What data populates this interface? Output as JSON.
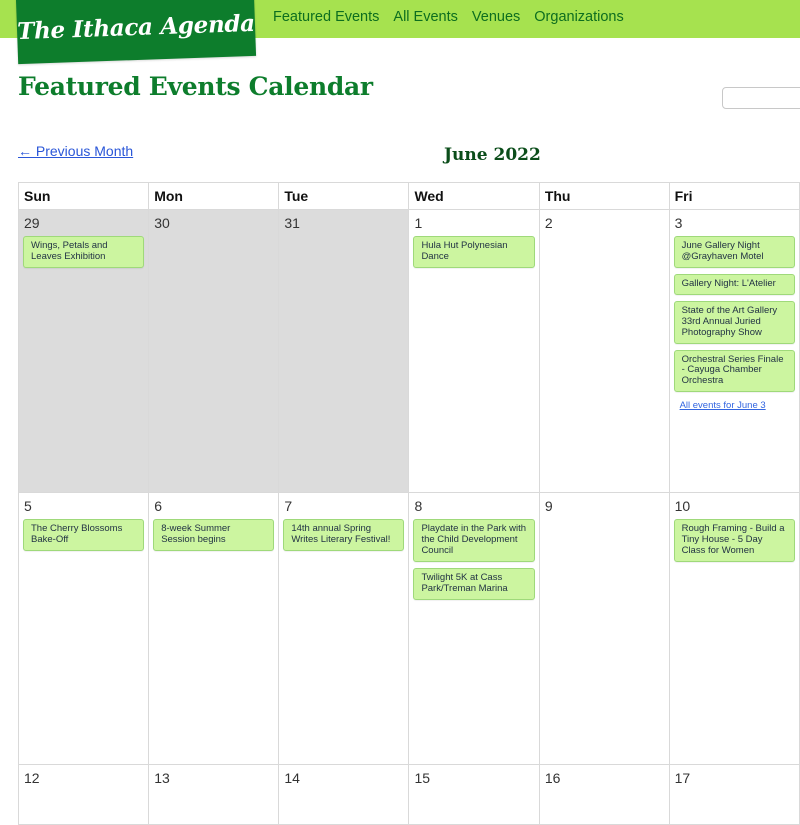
{
  "site": {
    "logo": "The Ithaca Agenda"
  },
  "nav": {
    "items": [
      "Featured Events",
      "All Events",
      "Venues",
      "Organizations"
    ]
  },
  "page": {
    "title": "Featured Events Calendar",
    "prev_label": "← Previous Month",
    "month_title": "June 2022"
  },
  "search": {
    "value": ""
  },
  "calendar": {
    "weekdays": [
      "Sun",
      "Mon",
      "Tue",
      "Wed",
      "Thu",
      "Fri"
    ],
    "weeks": [
      [
        {
          "day": "29",
          "other": true,
          "events": [
            "Wings, Petals and Leaves Exhibition"
          ]
        },
        {
          "day": "30",
          "other": true,
          "events": []
        },
        {
          "day": "31",
          "other": true,
          "events": []
        },
        {
          "day": "1",
          "events": [
            "Hula Hut Polynesian Dance"
          ]
        },
        {
          "day": "2",
          "events": []
        },
        {
          "day": "3",
          "events": [
            "June Gallery Night @Grayhaven Motel",
            "Gallery Night: L'Atelier",
            "State of the Art Gallery 33rd Annual Juried Photography Show",
            "Orchestral Series Finale - Cayuga Chamber Orchestra"
          ],
          "all_link": "All events for June 3"
        }
      ],
      [
        {
          "day": "5",
          "events": [
            "The Cherry Blossoms Bake-Off"
          ]
        },
        {
          "day": "6",
          "events": [
            "8-week Summer Session begins"
          ]
        },
        {
          "day": "7",
          "events": [
            "14th annual Spring Writes Literary Festival!"
          ]
        },
        {
          "day": "8",
          "events": [
            "Playdate in the Park with the Child Development Council",
            "Twilight 5K at Cass Park/Treman Marina"
          ]
        },
        {
          "day": "9",
          "events": []
        },
        {
          "day": "10",
          "events": [
            "Rough Framing - Build a Tiny House - 5 Day Class for Women"
          ]
        }
      ],
      [
        {
          "day": "12",
          "events": []
        },
        {
          "day": "13",
          "events": []
        },
        {
          "day": "14",
          "events": []
        },
        {
          "day": "15",
          "events": []
        },
        {
          "day": "16",
          "events": []
        },
        {
          "day": "17",
          "events": []
        }
      ]
    ]
  }
}
